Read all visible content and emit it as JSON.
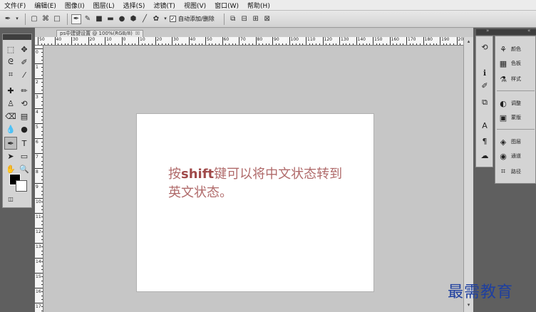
{
  "menu": [
    "文件(F)",
    "编辑(E)",
    "图像(I)",
    "图层(L)",
    "选择(S)",
    "滤镜(T)",
    "视图(V)",
    "窗口(W)",
    "帮助(H)"
  ],
  "options_bar": {
    "auto_add_delete_label": "自动添加/删除",
    "auto_add_delete_checked": true
  },
  "document": {
    "tab_title": "ps中建键设置 @ 100%(RGB/8)",
    "close_glyph": "☒",
    "ruler_top": [
      "50",
      "40",
      "30",
      "20",
      "10",
      "0",
      "10",
      "20",
      "30",
      "40",
      "50",
      "60",
      "70",
      "80",
      "90",
      "100",
      "110",
      "120",
      "130",
      "140",
      "150",
      "160",
      "170",
      "180",
      "190",
      "200"
    ],
    "ruler_left": [
      "0",
      "1",
      "2",
      "3",
      "4",
      "5",
      "6",
      "7",
      "8",
      "9",
      "10",
      "11",
      "12",
      "13",
      "14",
      "15",
      "16",
      "17"
    ],
    "canvas_text": {
      "line1_pre": "按",
      "line1_bold": "shift",
      "line1_post": "键可以将中文状态转到",
      "line2": "英文状态。"
    }
  },
  "panels": [
    {
      "icon": "⚘",
      "label": "颜色"
    },
    {
      "icon": "▦",
      "label": "色板"
    },
    {
      "icon": "⚗",
      "label": "样式"
    },
    {
      "icon": "◐",
      "label": "调整"
    },
    {
      "icon": "▣",
      "label": "蒙版"
    },
    {
      "icon": "◈",
      "label": "图层"
    },
    {
      "icon": "◉",
      "label": "通道"
    },
    {
      "icon": "⌗",
      "label": "路径"
    }
  ],
  "watermark": "最需教育",
  "colors": {
    "foreground": "#000000",
    "background": "#ffffff",
    "canvas_text": "#b06a6a",
    "watermark": "#1e3f9f"
  }
}
